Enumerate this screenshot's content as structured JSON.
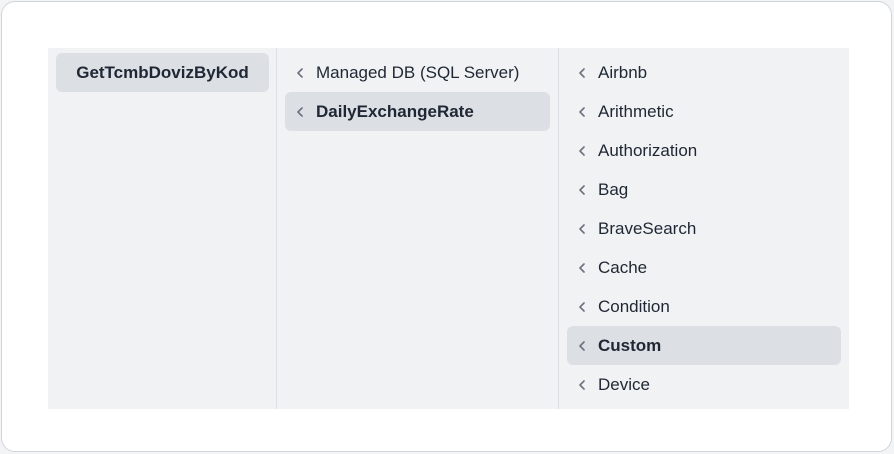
{
  "columns": [
    {
      "items": [
        {
          "label": "GetTcmbDovizByKod",
          "selected": true
        }
      ]
    },
    {
      "items": [
        {
          "label": "Managed DB (SQL Server)",
          "selected": false
        },
        {
          "label": "DailyExchangeRate",
          "selected": true
        }
      ]
    },
    {
      "items": [
        {
          "label": "Airbnb",
          "selected": false
        },
        {
          "label": "Arithmetic",
          "selected": false
        },
        {
          "label": "Authorization",
          "selected": false
        },
        {
          "label": "Bag",
          "selected": false
        },
        {
          "label": "BraveSearch",
          "selected": false
        },
        {
          "label": "Cache",
          "selected": false
        },
        {
          "label": "Condition",
          "selected": false
        },
        {
          "label": "Custom",
          "selected": true
        },
        {
          "label": "Device",
          "selected": false
        }
      ]
    }
  ],
  "icons": {
    "expand": "chevron-left-icon"
  }
}
